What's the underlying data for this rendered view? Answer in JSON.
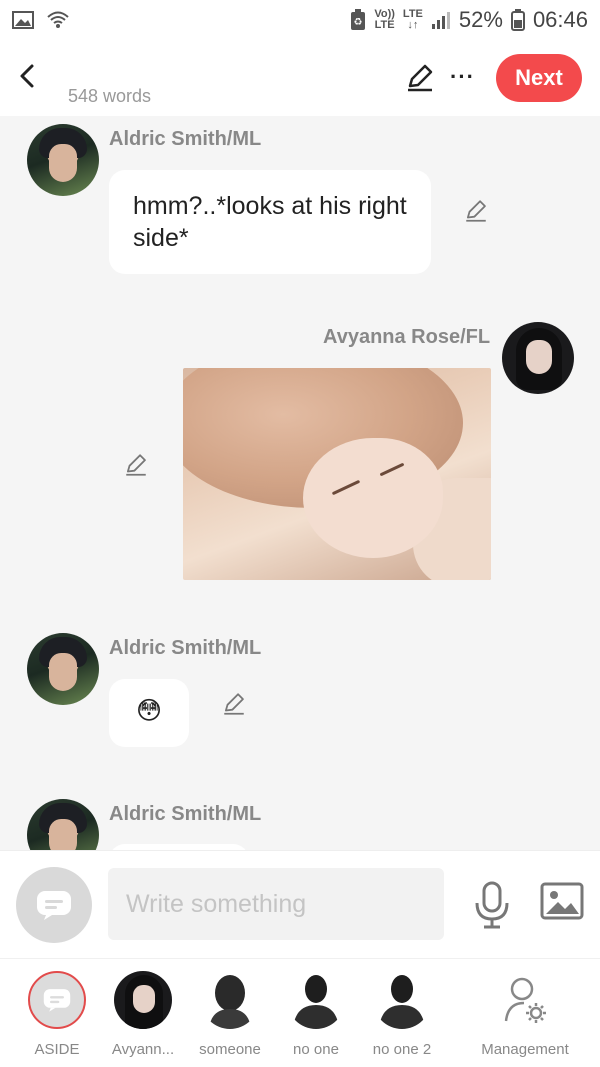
{
  "status_bar": {
    "network_top": "Vo))",
    "network_bottom": "LTE",
    "lte_top": "LTE",
    "lte_bottom": "↓↑",
    "battery": "52%",
    "time": "06:46"
  },
  "header": {
    "word_count": "548 words",
    "next_label": "Next",
    "more_label": "···"
  },
  "messages": [
    {
      "sender": "Aldric Smith/ML",
      "text": "hmm?..*looks at his right side*",
      "side": "left"
    },
    {
      "sender": "Avyanna Rose/FL",
      "type": "image",
      "side": "right"
    },
    {
      "sender": "Aldric Smith/ML",
      "text": "😳",
      "side": "left"
    },
    {
      "sender": "Aldric Smith/ML",
      "side": "left"
    }
  ],
  "composer": {
    "placeholder": "Write something"
  },
  "characters": [
    {
      "label": "ASIDE"
    },
    {
      "label": "Avyann..."
    },
    {
      "label": "someone"
    },
    {
      "label": "no one"
    },
    {
      "label": "no one 2"
    },
    {
      "label": "Management"
    }
  ],
  "colors": {
    "accent": "#f34a4c",
    "background": "#f5f5f5"
  },
  "icons": [
    "image-icon",
    "wifi-icon",
    "back-icon",
    "pencil-icon",
    "more-icon",
    "microphone-icon",
    "gallery-icon",
    "aside-icon",
    "user-settings-icon"
  ]
}
